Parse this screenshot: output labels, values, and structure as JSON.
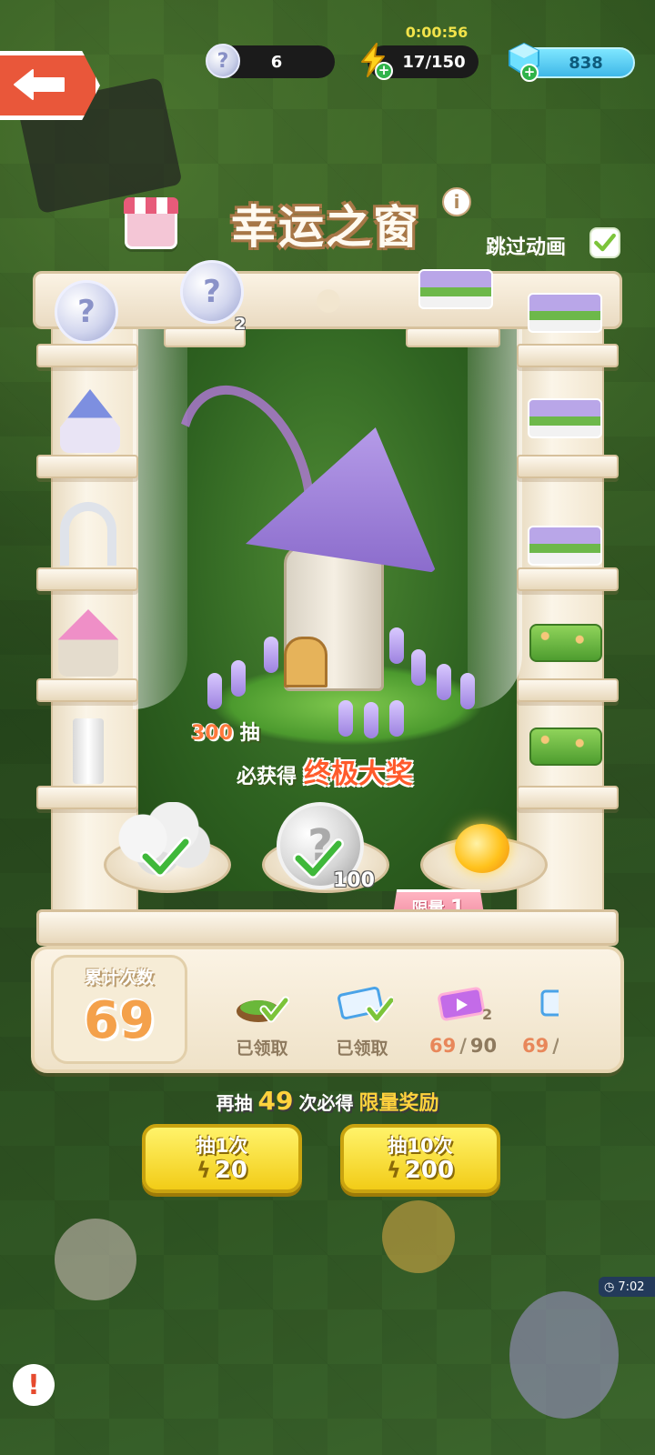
{
  "hud": {
    "coin_count": "6",
    "timer": "0:00:56",
    "energy": "17/150",
    "gems": "838"
  },
  "title": {
    "text": "幸运之窗",
    "skip_label": "跳过动画"
  },
  "shelf_items": {
    "top_coin_count": "2",
    "center_coin_count": "100"
  },
  "prize": {
    "draws": "300",
    "draws_unit": "抽",
    "guarantee": "必获得",
    "grand_prize": "终极大奖"
  },
  "limit_tag": {
    "label": "限量",
    "count": "1"
  },
  "counter": {
    "label": "累计次数",
    "value": "69"
  },
  "milestones": [
    {
      "label": "已领取"
    },
    {
      "label": "已领取"
    },
    {
      "badge": "2",
      "current": "69",
      "total": "90"
    },
    {
      "current": "69"
    }
  ],
  "tip": {
    "prefix": "再抽",
    "remaining": "49",
    "middle": "次必得",
    "reward": "限量奖励"
  },
  "buttons": {
    "draw1_label": "抽1次",
    "draw1_cost": "20",
    "draw10_label": "抽10次",
    "draw10_cost": "200"
  },
  "side_clock": "7:02",
  "colors": {
    "accent_yellow": "#f2cc17",
    "back_button": "#e9573a",
    "prize_orange": "#ff5a2b",
    "limit_pink": "#f08aa0"
  },
  "icons": [
    "back-arrow-icon",
    "silver-coin-icon",
    "energy-bolt-icon",
    "gem-icon",
    "info-icon",
    "check-icon",
    "shop-icon"
  ]
}
